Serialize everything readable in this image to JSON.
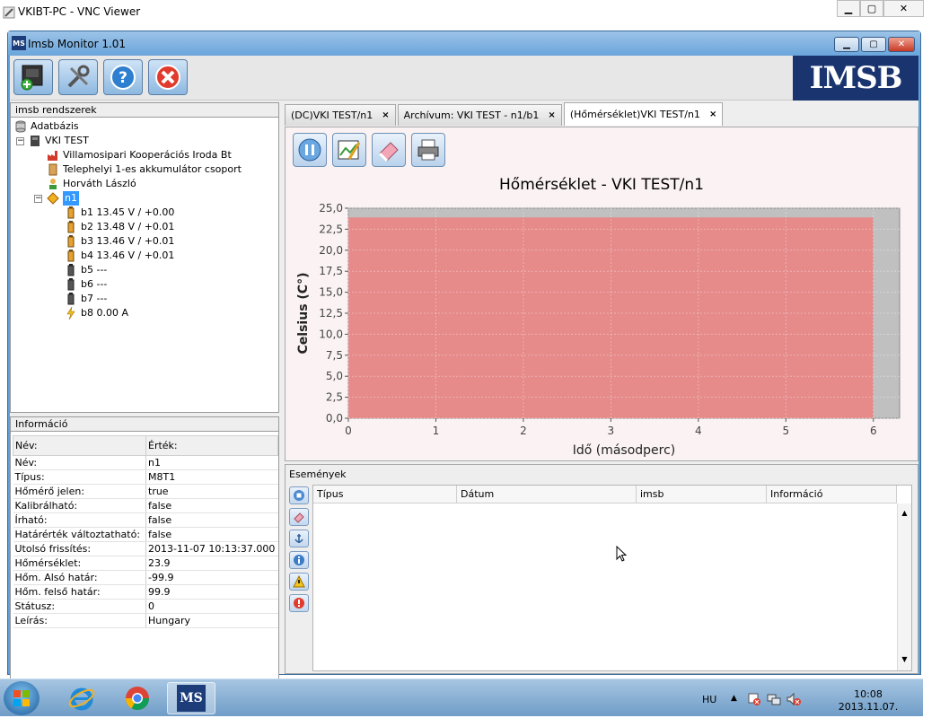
{
  "vnc_window": {
    "title": "VKIBT-PC - VNC Viewer"
  },
  "app_window": {
    "title": "Imsb Monitor 1.01",
    "icon_text": "MS"
  },
  "logo": {
    "text": "IMSB"
  },
  "tree_panel": {
    "caption": "imsb rendszerek",
    "items": [
      {
        "label": "Adatbázis"
      },
      {
        "label": "VKI TEST"
      },
      {
        "label": "Villamosipari Kooperációs Iroda Bt"
      },
      {
        "label": "Telephelyi 1-es akkumulátor csoport"
      },
      {
        "label": "Horváth László"
      },
      {
        "label": "n1"
      },
      {
        "label": "b1  13.45 V / +0.00"
      },
      {
        "label": "b2  13.48 V / +0.01"
      },
      {
        "label": "b3  13.46 V / +0.01"
      },
      {
        "label": "b4  13.46 V / +0.01"
      },
      {
        "label": "b5  ---"
      },
      {
        "label": "b6  ---"
      },
      {
        "label": "b7  ---"
      },
      {
        "label": "b8  0.00 A"
      }
    ]
  },
  "info_panel": {
    "caption": "Információ",
    "headers": [
      "Név:",
      "Érték:"
    ],
    "rows": [
      [
        "Név:",
        "n1"
      ],
      [
        "Típus:",
        "M8T1"
      ],
      [
        "Hőmérő jelen:",
        "true"
      ],
      [
        "Kalibrálható:",
        "false"
      ],
      [
        "Írható:",
        "false"
      ],
      [
        "Határérték változtatható:",
        "false"
      ],
      [
        "Utolsó frissítés:",
        "2013-11-07 10:13:37.000"
      ],
      [
        "Hőmérséklet:",
        "23.9"
      ],
      [
        "Hőm. Alsó határ:",
        "-99.9"
      ],
      [
        "Hőm. felső határ:",
        "99.9"
      ],
      [
        "Státusz:",
        "0"
      ],
      [
        "Leírás:",
        "Hungary"
      ]
    ]
  },
  "tabs": [
    {
      "label": "(DC)VKI TEST/n1",
      "close": "×"
    },
    {
      "label": "Archívum: VKI TEST - n1/b1",
      "close": "×"
    },
    {
      "label": "(Hőmérséklet)VKI TEST/n1",
      "close": "×"
    }
  ],
  "events_panel": {
    "caption": "Események",
    "columns": [
      "Típus",
      "Dátum",
      "imsb",
      "Információ"
    ]
  },
  "taskbar": {
    "language": "HU",
    "time": "10:08",
    "date": "2013.11.07."
  },
  "icons": {
    "toolbar": [
      "processor-add-icon",
      "tools-icon",
      "help-icon",
      "close-icon"
    ],
    "chart_toolbar": [
      "pause-icon",
      "chart-edit-icon",
      "eraser-icon",
      "printer-icon"
    ],
    "events_side": [
      "stop-icon",
      "eraser-icon",
      "anchor-icon",
      "info-icon",
      "warning-icon",
      "error-icon"
    ]
  },
  "colors": {
    "fill": "#e68a8a",
    "plot_bg": "#c0c0c0",
    "panel_bg": "#eeeeee"
  },
  "chart_data": {
    "type": "area",
    "title": "Hőmérséklet - VKI TEST/n1",
    "xlabel": "Idő (másodperc)",
    "ylabel": "Celsius (C°)",
    "x": [
      0,
      6
    ],
    "values": [
      23.9,
      23.9
    ],
    "xlim": [
      0,
      6.3
    ],
    "ylim": [
      0,
      25
    ],
    "xticks": [
      "0",
      "1",
      "2",
      "3",
      "4",
      "5",
      "6"
    ],
    "yticks": [
      "0,0",
      "2,5",
      "5,0",
      "7,5",
      "10,0",
      "12,5",
      "15,0",
      "17,5",
      "20,0",
      "22,5",
      "25,0"
    ],
    "grid": true
  }
}
